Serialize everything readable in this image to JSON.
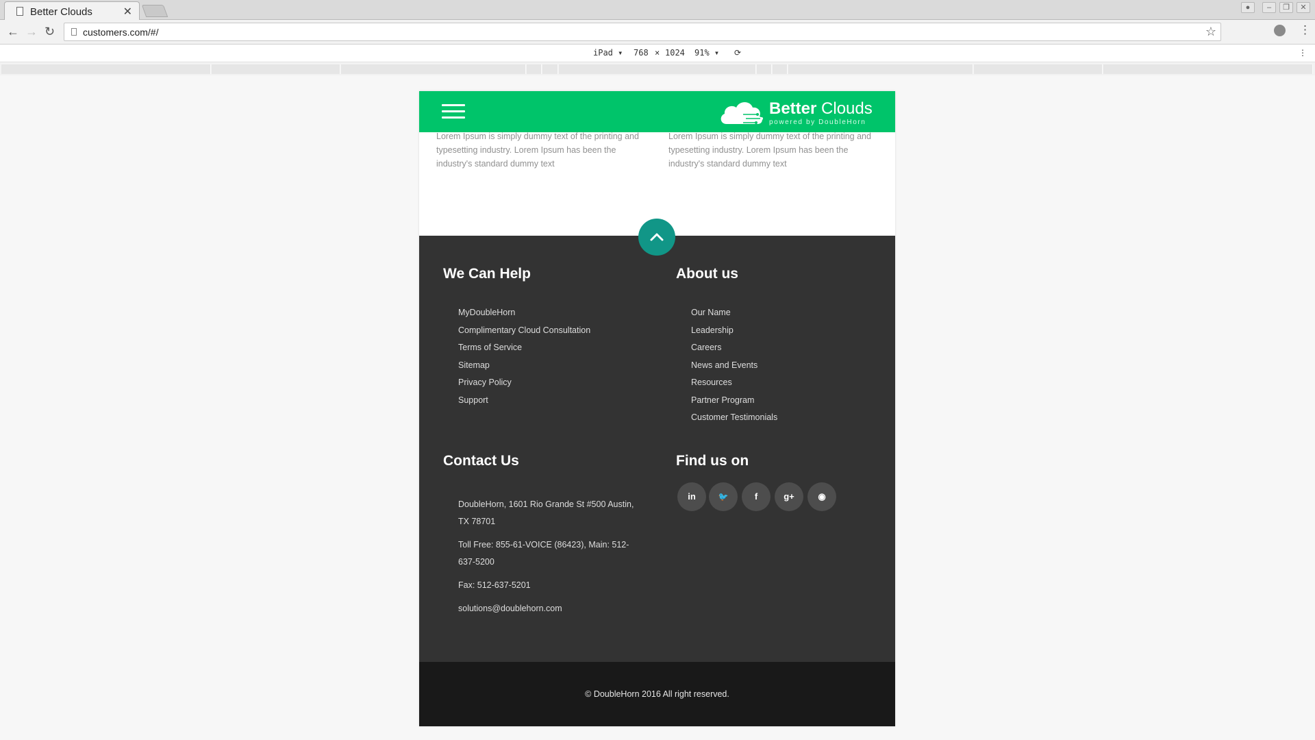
{
  "browser": {
    "tab_title": "Better Clouds",
    "tab_close": "✕",
    "url": "customers.com/#/",
    "device": "iPad",
    "width": "768",
    "times": "×",
    "height": "1024",
    "zoom": "91%"
  },
  "header": {
    "brand_bold": "Better",
    "brand_light": " Clouds",
    "tagline": "powered by DoubleHorn"
  },
  "intro": [
    "Lorem Ipsum is simply dummy text of the printing and typesetting industry. Lorem Ipsum has been the industry's standard dummy text",
    "Lorem Ipsum is simply dummy text of the printing and typesetting industry. Lorem Ipsum has been the industry's standard dummy text"
  ],
  "help": {
    "title": "We Can Help",
    "links": [
      "MyDoubleHorn",
      "Complimentary Cloud Consultation",
      "Terms of Service",
      "Sitemap",
      "Privacy Policy",
      "Support"
    ]
  },
  "about": {
    "title": "About us",
    "links": [
      "Our Name",
      "Leadership",
      "Careers",
      "News and Events",
      "Resources",
      "Partner Program",
      "Customer Testimonials"
    ]
  },
  "contact": {
    "title": "Contact Us",
    "address": "DoubleHorn, 1601 Rio Grande St #500 Austin, TX 78701",
    "phone": "Toll Free: 855-61-VOICE (86423), Main: 512-637-5200",
    "fax": "Fax: 512-637-5201",
    "email": "solutions@doublehorn.com"
  },
  "social": {
    "title": "Find us on",
    "icons": [
      "linkedin-icon",
      "twitter-icon",
      "facebook-icon",
      "google-plus-icon",
      "rss-icon"
    ],
    "glyphs": [
      "in",
      "🐦",
      "f",
      "g+",
      "◉"
    ]
  },
  "copyright": "© DoubleHorn 2016 All right reserved.",
  "colors": {
    "header_green": "#00c46a",
    "footer_dark": "#333333",
    "bottom_bar": "#191919",
    "scroll_top_teal": "#119687"
  }
}
